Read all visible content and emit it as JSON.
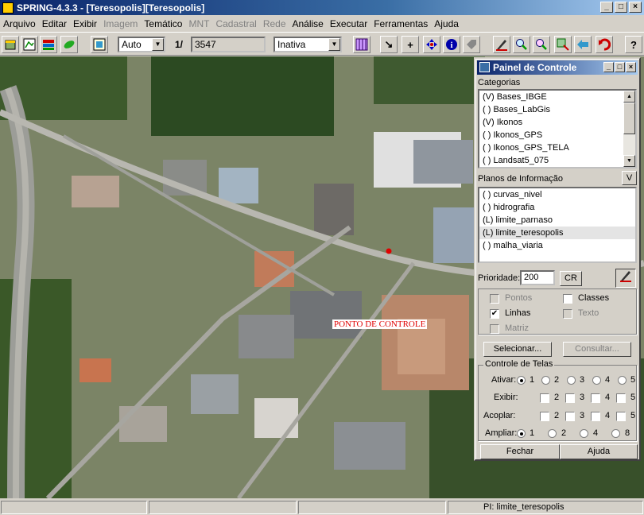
{
  "window": {
    "title": "SPRING-4.3.3 - [Teresopolis][Teresopolis]"
  },
  "menu": [
    {
      "label": "Arquivo",
      "enabled": true
    },
    {
      "label": "Editar",
      "enabled": true
    },
    {
      "label": "Exibir",
      "enabled": true
    },
    {
      "label": "Imagem",
      "enabled": false
    },
    {
      "label": "Temático",
      "enabled": true
    },
    {
      "label": "MNT",
      "enabled": false
    },
    {
      "label": "Cadastral",
      "enabled": false
    },
    {
      "label": "Rede",
      "enabled": false
    },
    {
      "label": "Análise",
      "enabled": true
    },
    {
      "label": "Executar",
      "enabled": true
    },
    {
      "label": "Ferramentas",
      "enabled": true
    },
    {
      "label": "Ajuda",
      "enabled": true
    }
  ],
  "toolbar": {
    "scale_mode": "Auto",
    "scale_prefix": "1/",
    "scale_value": "3547",
    "cursor_mode": "Inativa",
    "question_label": "?"
  },
  "map": {
    "label": "PONTO DE CONTROLE",
    "label_color": "#e00000"
  },
  "panel": {
    "title": "Painel de Controle",
    "categories_label": "Categorias",
    "categories": [
      "(V) Bases_IBGE",
      "( ) Bases_LabGis",
      "(V) Ikonos",
      "( ) Ikonos_GPS",
      "( ) Ikonos_GPS_TELA",
      "( ) Landsat5_075"
    ],
    "planes_label": "Planos de Informação",
    "planes_button": "V",
    "planes": [
      "( ) curvas_nivel",
      "( ) hidrografia",
      "(L) limite_parnaso",
      "(L) limite_teresopolis",
      "( ) malha_viaria"
    ],
    "selected_plane_index": 3,
    "priority_label": "Prioridade:",
    "priority_value": "200",
    "cr_button": "CR",
    "checks": {
      "pontos": {
        "label": "Pontos",
        "checked": false,
        "enabled": false
      },
      "classes": {
        "label": "Classes",
        "checked": false,
        "enabled": true
      },
      "linhas": {
        "label": "Linhas",
        "checked": true,
        "enabled": true
      },
      "texto": {
        "label": "Texto",
        "checked": false,
        "enabled": false
      },
      "matriz": {
        "label": "Matriz",
        "checked": false,
        "enabled": false
      }
    },
    "select_button": "Selecionar...",
    "consult_button": "Consultar...",
    "screens": {
      "group_label": "Controle de Telas",
      "ativar_label": "Ativar:",
      "exibir_label": "Exibir:",
      "acoplar_label": "Acoplar:",
      "ampliar_label": "Ampliar:",
      "numbers": [
        "1",
        "2",
        "3",
        "4",
        "5"
      ],
      "ampliar_options": [
        "1",
        "2",
        "4",
        "8"
      ]
    },
    "close_button": "Fechar",
    "help_button": "Ajuda"
  },
  "status": {
    "plane": "PI: limite_teresopolis"
  }
}
